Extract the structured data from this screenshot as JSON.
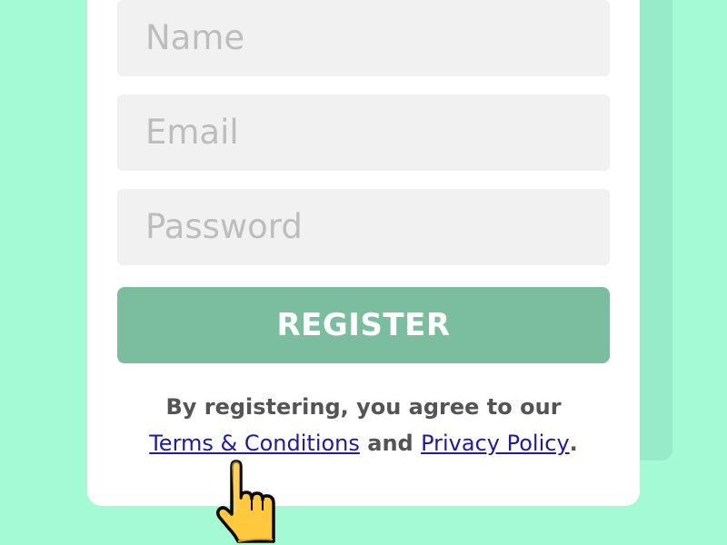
{
  "form": {
    "name_placeholder": "Name",
    "email_placeholder": "Email",
    "password_placeholder": "Password",
    "register_label": "REGISTER"
  },
  "agreement": {
    "prefix": "By registering, you agree to our",
    "terms_link": "Terms & Conditions",
    "conjunction": "and",
    "privacy_link": "Privacy Policy",
    "suffix": "."
  },
  "cursor": {
    "icon": "pointing-hand-icon"
  },
  "colors": {
    "background": "#a3fad3",
    "back_card": "#97ebc8",
    "card": "#ffffff",
    "field": "#f1f1f1",
    "button": "#7bbd9f",
    "link": "#1f1aa8",
    "cursor_fill": "#ffc83d"
  }
}
